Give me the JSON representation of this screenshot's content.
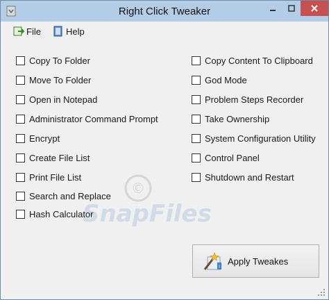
{
  "window": {
    "title": "Right Click Tweaker"
  },
  "menu": [
    {
      "label": "File",
      "icon": "file-menu-icon"
    },
    {
      "label": "Help",
      "icon": "help-book-icon"
    }
  ],
  "options_left": [
    {
      "label": "Copy To Folder",
      "checked": false
    },
    {
      "label": "Move To Folder",
      "checked": false
    },
    {
      "label": "Open in Notepad",
      "checked": false
    },
    {
      "label": "Administrator Command Prompt",
      "checked": false
    },
    {
      "label": "Encrypt",
      "checked": false
    },
    {
      "label": "Create File List",
      "checked": false
    },
    {
      "label": "Print File List",
      "checked": false
    },
    {
      "label": "Search and Replace",
      "checked": false
    },
    {
      "label": "Hash Calculator",
      "checked": false
    }
  ],
  "options_right": [
    {
      "label": "Copy Content To Clipboard",
      "checked": false
    },
    {
      "label": "God Mode",
      "checked": false
    },
    {
      "label": "Problem Steps Recorder",
      "checked": false
    },
    {
      "label": "Take Ownership",
      "checked": false
    },
    {
      "label": "System Configuration Utility",
      "checked": false
    },
    {
      "label": "Control Panel",
      "checked": false
    },
    {
      "label": "Shutdown and Restart",
      "checked": false
    }
  ],
  "apply_button": {
    "label": "Apply Tweakes"
  },
  "colors": {
    "titlebar": "#b4cde6",
    "close": "#c75050",
    "window_bg": "#f0f0f0"
  }
}
